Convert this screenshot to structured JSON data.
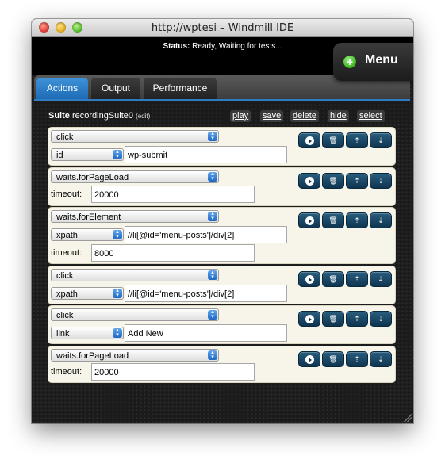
{
  "window": {
    "title": "http://wptesi – Windmill IDE"
  },
  "status": {
    "label": "Status:",
    "text": "Ready, Waiting for tests..."
  },
  "menu": {
    "label": "Menu",
    "plus": "+"
  },
  "tabs": [
    {
      "label": "Actions",
      "active": true
    },
    {
      "label": "Output",
      "active": false
    },
    {
      "label": "Performance",
      "active": false
    }
  ],
  "suite": {
    "prefix": "Suite",
    "name": "recordingSuite0",
    "edit": "(edit)",
    "actions": {
      "play": "play",
      "save": "save",
      "delete": "delete",
      "hide": "hide",
      "select": "select"
    }
  },
  "actions": [
    {
      "method": "click",
      "locator": "id",
      "value": "wp-submit"
    },
    {
      "method": "waits.forPageLoad",
      "option_label": "timeout:",
      "option_value": "20000"
    },
    {
      "method": "waits.forElement",
      "locator": "xpath",
      "value": "//li[@id='menu-posts']/div[2]",
      "option_label": "timeout:",
      "option_value": "8000"
    },
    {
      "method": "click",
      "locator": "xpath",
      "value": "//li[@id='menu-posts']/div[2]"
    },
    {
      "method": "click",
      "locator": "link",
      "value": "Add New"
    },
    {
      "method": "waits.forPageLoad",
      "option_label": "timeout:",
      "option_value": "20000"
    }
  ],
  "icons": {
    "play": "play-circle",
    "delete": "trash",
    "move_up": "arrow-up",
    "move_down": "arrow-down"
  },
  "colors": {
    "active_tab": "#2f7cc2",
    "button": "#1a4b6b",
    "row_bg": "#f7f5e9"
  }
}
